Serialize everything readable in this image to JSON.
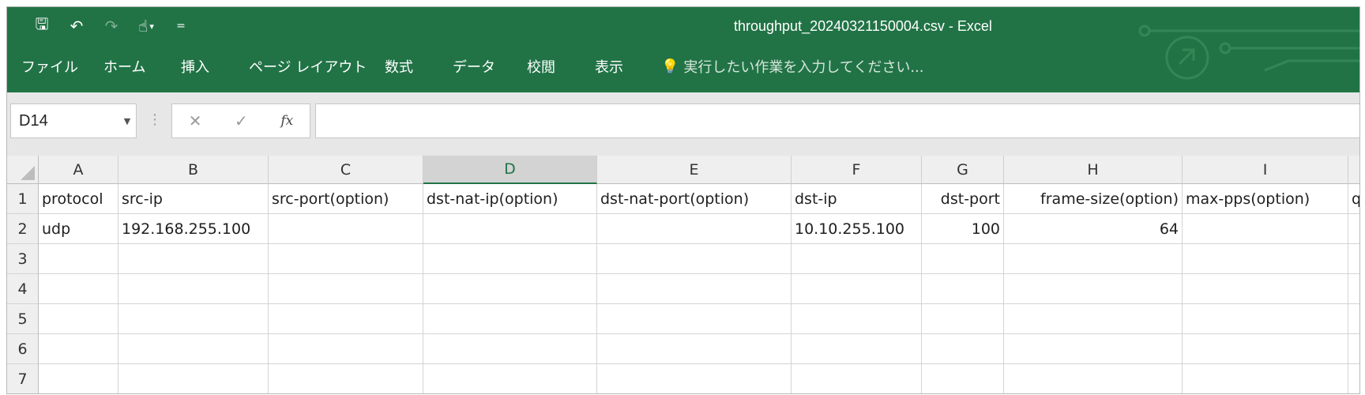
{
  "window": {
    "title": "throughput_20240321150004.csv - Excel"
  },
  "quick_access": [
    {
      "icon": "save-icon",
      "glyph": "🖫"
    },
    {
      "icon": "undo-icon",
      "glyph": "↶"
    },
    {
      "icon": "redo-icon",
      "glyph": "↷"
    },
    {
      "icon": "touch-mode-icon",
      "glyph": "☝"
    },
    {
      "icon": "customize-qat-icon",
      "glyph": "="
    }
  ],
  "ribbon": {
    "tabs": [
      "ファイル",
      "ホーム",
      "挿入",
      "ページ レイアウト",
      "数式",
      "データ",
      "校閲",
      "表示"
    ],
    "tell_me": "実行したい作業を入力してください..."
  },
  "formula_bar": {
    "name_box": "D14",
    "cancel_glyph": "✕",
    "enter_glyph": "✓",
    "fx_label": "fx",
    "content": ""
  },
  "sheet": {
    "selected_cell": "D14",
    "columns": [
      "A",
      "B",
      "C",
      "D",
      "E",
      "F",
      "G",
      "H",
      "I",
      ""
    ],
    "rows": [
      {
        "num": "1",
        "cells": [
          "protocol",
          "src-ip",
          "src-port(option)",
          "dst-nat-ip(option)",
          "dst-nat-port(option)",
          "dst-ip",
          "dst-port",
          "frame-size(option)",
          "max-pps(option)",
          "q"
        ]
      },
      {
        "num": "2",
        "cells": [
          "udp",
          "192.168.255.100",
          "",
          "",
          "",
          "10.10.255.100",
          "100",
          "64",
          "",
          ""
        ]
      },
      {
        "num": "3",
        "cells": [
          "",
          "",
          "",
          "",
          "",
          "",
          "",
          "",
          "",
          ""
        ]
      },
      {
        "num": "4",
        "cells": [
          "",
          "",
          "",
          "",
          "",
          "",
          "",
          "",
          "",
          ""
        ]
      },
      {
        "num": "5",
        "cells": [
          "",
          "",
          "",
          "",
          "",
          "",
          "",
          "",
          "",
          ""
        ]
      },
      {
        "num": "6",
        "cells": [
          "",
          "",
          "",
          "",
          "",
          "",
          "",
          "",
          "",
          ""
        ]
      },
      {
        "num": "7",
        "cells": [
          "",
          "",
          "",
          "",
          "",
          "",
          "",
          "",
          "",
          ""
        ]
      }
    ]
  },
  "colors": {
    "excel_green": "#217346",
    "header_gray": "#efefef",
    "selected_header": "#d3d3d3"
  }
}
